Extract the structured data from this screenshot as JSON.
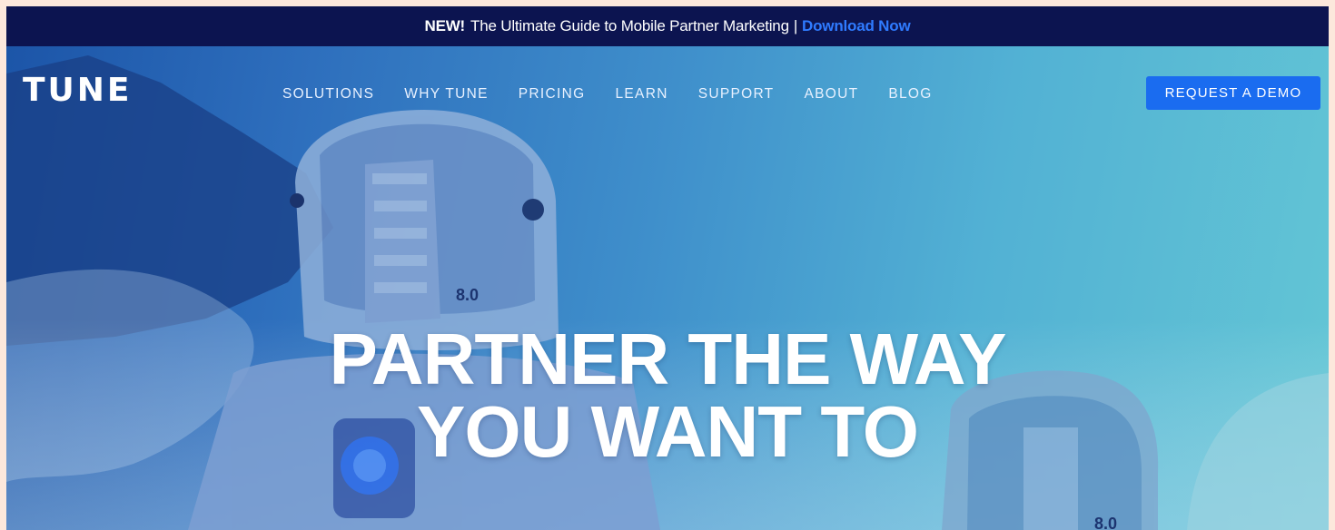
{
  "announcement": {
    "new_label": "NEW!",
    "text": "The Ultimate Guide to Mobile Partner Marketing",
    "separator": "|",
    "link_label": "Download Now",
    "link_color": "#2f7bff"
  },
  "nav": {
    "logo": "TUNE",
    "items": [
      "SOLUTIONS",
      "WHY TUNE",
      "PRICING",
      "LEARN",
      "SUPPORT",
      "ABOUT",
      "BLOG"
    ],
    "cta_label": "REQUEST A DEMO",
    "cta_color": "#1a6cf0"
  },
  "hero": {
    "headline_line1": "PARTNER THE WAY",
    "headline_line2": "YOU WANT TO",
    "helmet_label_1": "8.0",
    "helmet_label_2": "8.0",
    "image_description_icon": "astronaut-illustration"
  },
  "colors": {
    "announce_bg": "#0c1450",
    "hero_left": "#1c55a8",
    "hero_right": "#63c6d5"
  }
}
